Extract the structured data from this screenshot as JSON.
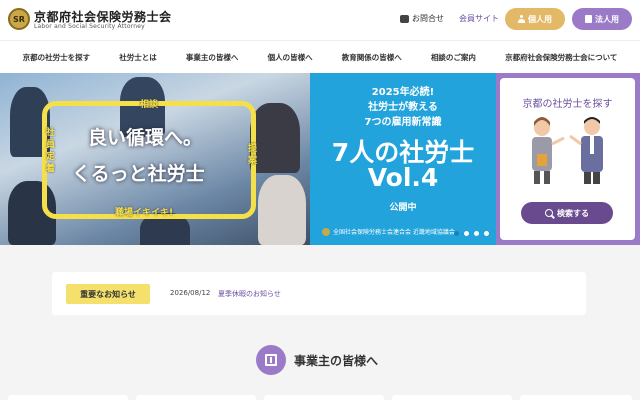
{
  "header": {
    "logo_mark": "SR",
    "title": "京都府社会保険労務士会",
    "subtitle": "Labor and Social Security Attorney",
    "contact_label": "お問合せ",
    "member_label": "会員サイト",
    "personal_button": "個人用",
    "corporate_button": "法人用"
  },
  "nav": {
    "items": [
      {
        "label": "京都の社労士を探す"
      },
      {
        "label": "社労士とは"
      },
      {
        "label": "事業主の皆様へ"
      },
      {
        "label": "個人の皆様へ"
      },
      {
        "label": "教育関係の皆様へ"
      },
      {
        "label": "相談のご案内"
      },
      {
        "label": "京都府社会保険労務士会について"
      }
    ]
  },
  "hero": {
    "left": {
      "label_top": "相談",
      "label_right": "提案",
      "label_left": "社員定着",
      "label_bottom": "職場イキイキ!",
      "line1": "良い循環へ。",
      "line2": "くるっと社労士"
    },
    "middle": {
      "l1": "2025年必読!",
      "l2": "社労士が教える",
      "l3": "7つの雇用新常識",
      "big1": "7人の社労士",
      "big2": "Vol.4",
      "status": "公開中",
      "footer": "全国社会保険労務士会連合会 近畿地域協議会"
    },
    "find": {
      "title": "京都の社労士を探す",
      "button": "検索する"
    }
  },
  "notice": {
    "badge": "重要なお知らせ",
    "date": "2026/08/12",
    "text": "夏季休暇のお知らせ"
  },
  "section": {
    "title": "事業主の皆様へ"
  },
  "colors": {
    "gold": "#e3b866",
    "purple": "#9b7bc7",
    "deep_purple": "#6a4a8f",
    "hero_blue": "#22a3dc",
    "notice_yellow": "#f4e06a",
    "arrow_yellow": "#f5e04a"
  }
}
